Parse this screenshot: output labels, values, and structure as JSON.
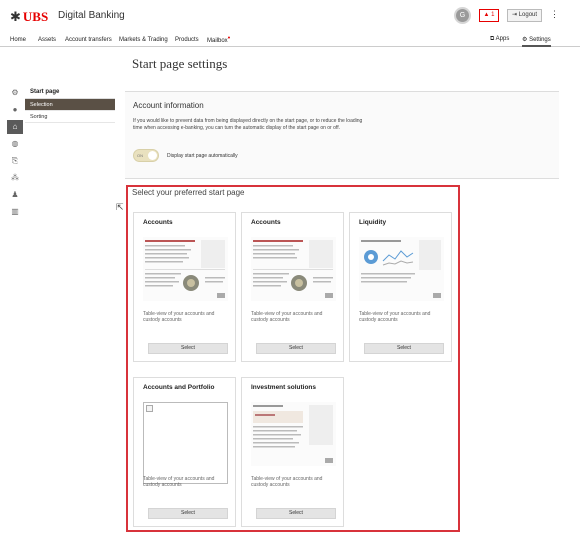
{
  "header": {
    "brand": "UBS",
    "app_title": "Digital Banking",
    "avatar_initial": "G",
    "notification_count": "1",
    "logout_label": "Logout"
  },
  "nav": {
    "items": [
      "Home",
      "Assets",
      "Account transfers",
      "Markets & Trading",
      "Products",
      "Mailbox"
    ],
    "apps_label": "Apps",
    "settings_label": "Settings"
  },
  "rail": {
    "icons": [
      "gear-icon",
      "person-icon",
      "home-icon",
      "globe-icon",
      "document-export-icon",
      "sitemap-icon",
      "users-icon",
      "columns-icon"
    ]
  },
  "side_menu": {
    "title": "Start page",
    "items": [
      "Selection",
      "Sorting"
    ]
  },
  "page": {
    "title": "Start page settings"
  },
  "account_info": {
    "title": "Account information",
    "description": "If you would like to prevent data from being displayed directly on the start page, or to reduce the loading time when accessing e-banking, you can turn the automatic display of the start page on or off.",
    "toggle_state": "ON",
    "toggle_label": "Display start page automatically"
  },
  "start_page_selection": {
    "title": "Select your preferred start page",
    "cards": [
      {
        "title": "Accounts",
        "description": "Table-view of your accounts and custody accounts",
        "button": "Select"
      },
      {
        "title": "Accounts",
        "description": "Table-view of your accounts and custody accounts",
        "button": "Select"
      },
      {
        "title": "Liquidity",
        "description": "Table-view of your accounts and custody accounts",
        "button": "Select"
      },
      {
        "title": "Accounts and Portfolio",
        "description": "Table-view of your accounts and custody accounts",
        "button": "Select"
      },
      {
        "title": "Investment solutions",
        "description": "Table-view of your accounts and custody accounts",
        "button": "Select"
      }
    ]
  },
  "colors": {
    "brand_red": "#e60000",
    "selection_frame": "#d8333b",
    "selected_menu": "#5a5045"
  }
}
